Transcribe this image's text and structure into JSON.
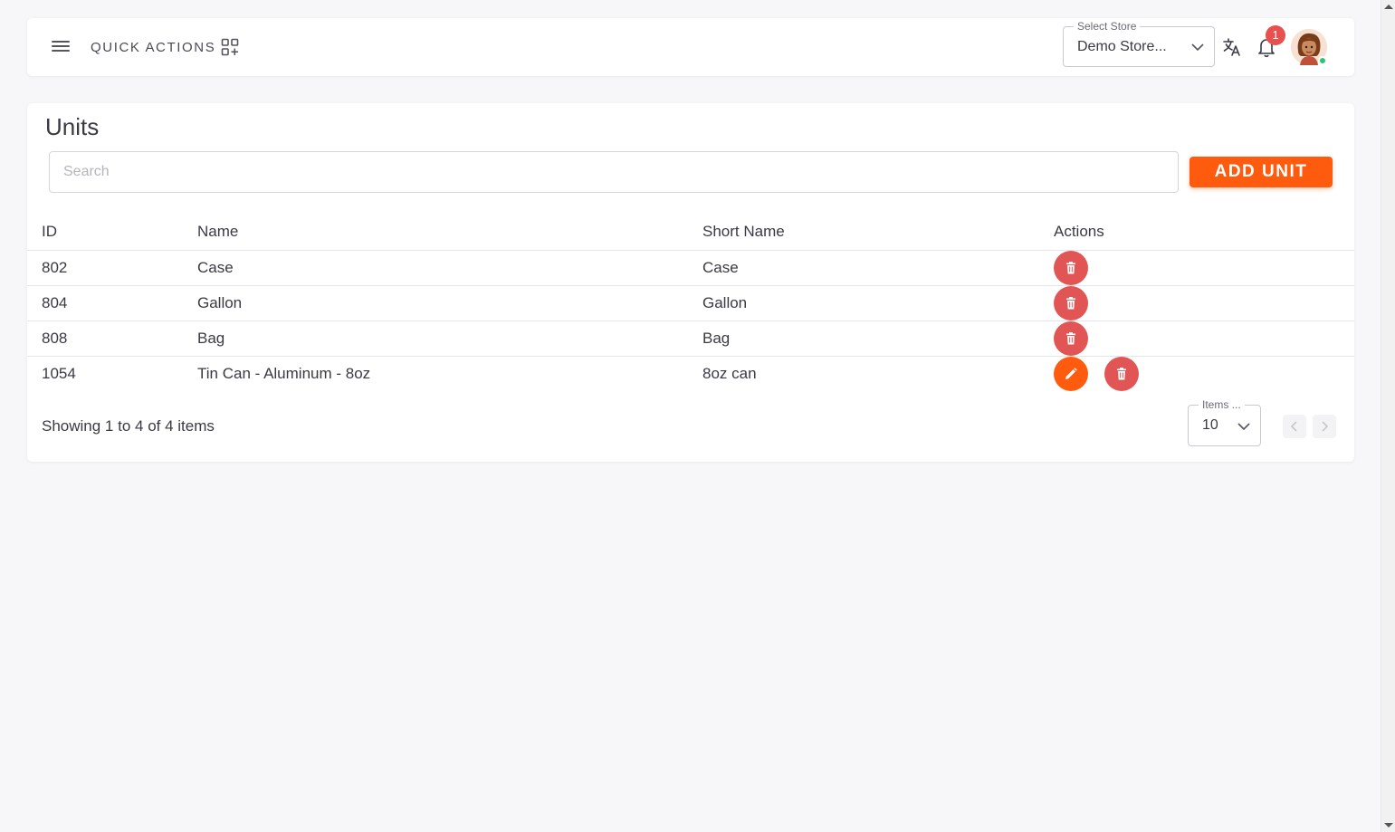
{
  "header": {
    "quick_actions_label": "QUICK ACTIONS",
    "store_select": {
      "legend": "Select Store",
      "value": "Demo Store..."
    },
    "notification_count": "1"
  },
  "units": {
    "title": "Units",
    "search_placeholder": "Search",
    "add_button_label": "ADD UNIT",
    "columns": {
      "id": "ID",
      "name": "Name",
      "short_name": "Short Name",
      "actions": "Actions"
    },
    "rows": [
      {
        "id": "802",
        "name": "Case",
        "short_name": "Case",
        "editable": false
      },
      {
        "id": "804",
        "name": "Gallon",
        "short_name": "Gallon",
        "editable": false
      },
      {
        "id": "808",
        "name": "Bag",
        "short_name": "Bag",
        "editable": false
      },
      {
        "id": "1054",
        "name": "Tin Can - Aluminum - 8oz",
        "short_name": "8oz can",
        "editable": true
      }
    ],
    "showing_text": "Showing 1 to 4 of 4 items",
    "items_per_page": {
      "legend": "Items ...",
      "value": "10"
    }
  },
  "colors": {
    "accent": "#ff5b0f",
    "delete": "#e25555",
    "badge": "#e84f4f",
    "online": "#28c76f"
  }
}
